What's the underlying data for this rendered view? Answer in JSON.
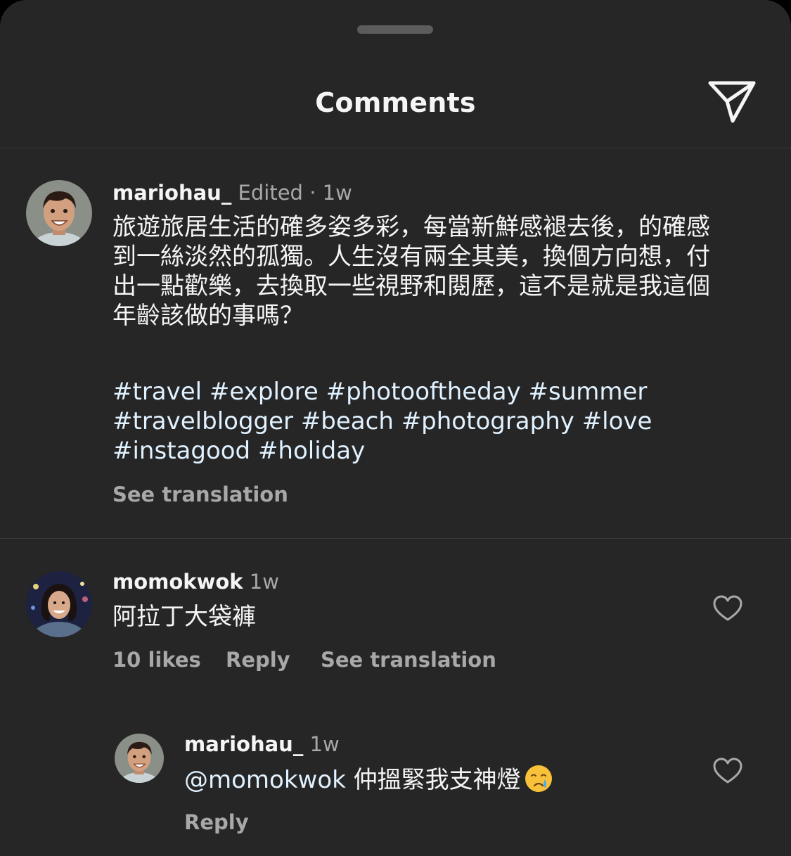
{
  "header": {
    "title": "Comments",
    "share_icon": "send-paper-plane-icon"
  },
  "caption": {
    "username": "mariohau_",
    "edited_label": "Edited",
    "separator": "·",
    "timestamp": "1w",
    "text_lines": [
      "旅遊旅居生活的確多姿多彩，每當新鮮感褪去後，的確感",
      "到一絲淡然的孤獨。人生沒有兩全其美，換個方向想，付",
      "出一點歡樂，去換取一些視野和閱歷，這不是就是我這個",
      "年齡該做的事嗎？"
    ],
    "hashtag_lines": [
      "#travel #explore #photooftheday #summer",
      "#travelblogger #beach #photography #love",
      "#instagood #holiday"
    ],
    "see_translation": "See translation"
  },
  "comments": [
    {
      "username": "momokwok",
      "timestamp": "1w",
      "text": "阿拉丁大袋褲",
      "likes": "10 likes",
      "reply": "Reply",
      "see_translation": "See translation",
      "like_icon": "heart-outline-icon"
    }
  ],
  "replies": [
    {
      "username": "mariohau_",
      "timestamp": "1w",
      "mention": "@momokwok",
      "text": "仲搵緊我支神燈",
      "emoji": "crying-face-emoji",
      "reply": "Reply",
      "like_icon": "heart-outline-icon"
    }
  ],
  "colors": {
    "background": "#262626",
    "primary_text": "#f5f5f5",
    "secondary_text": "#a8a8a8",
    "link_text": "#e0f1ff",
    "divider": "#3a3a3a"
  }
}
